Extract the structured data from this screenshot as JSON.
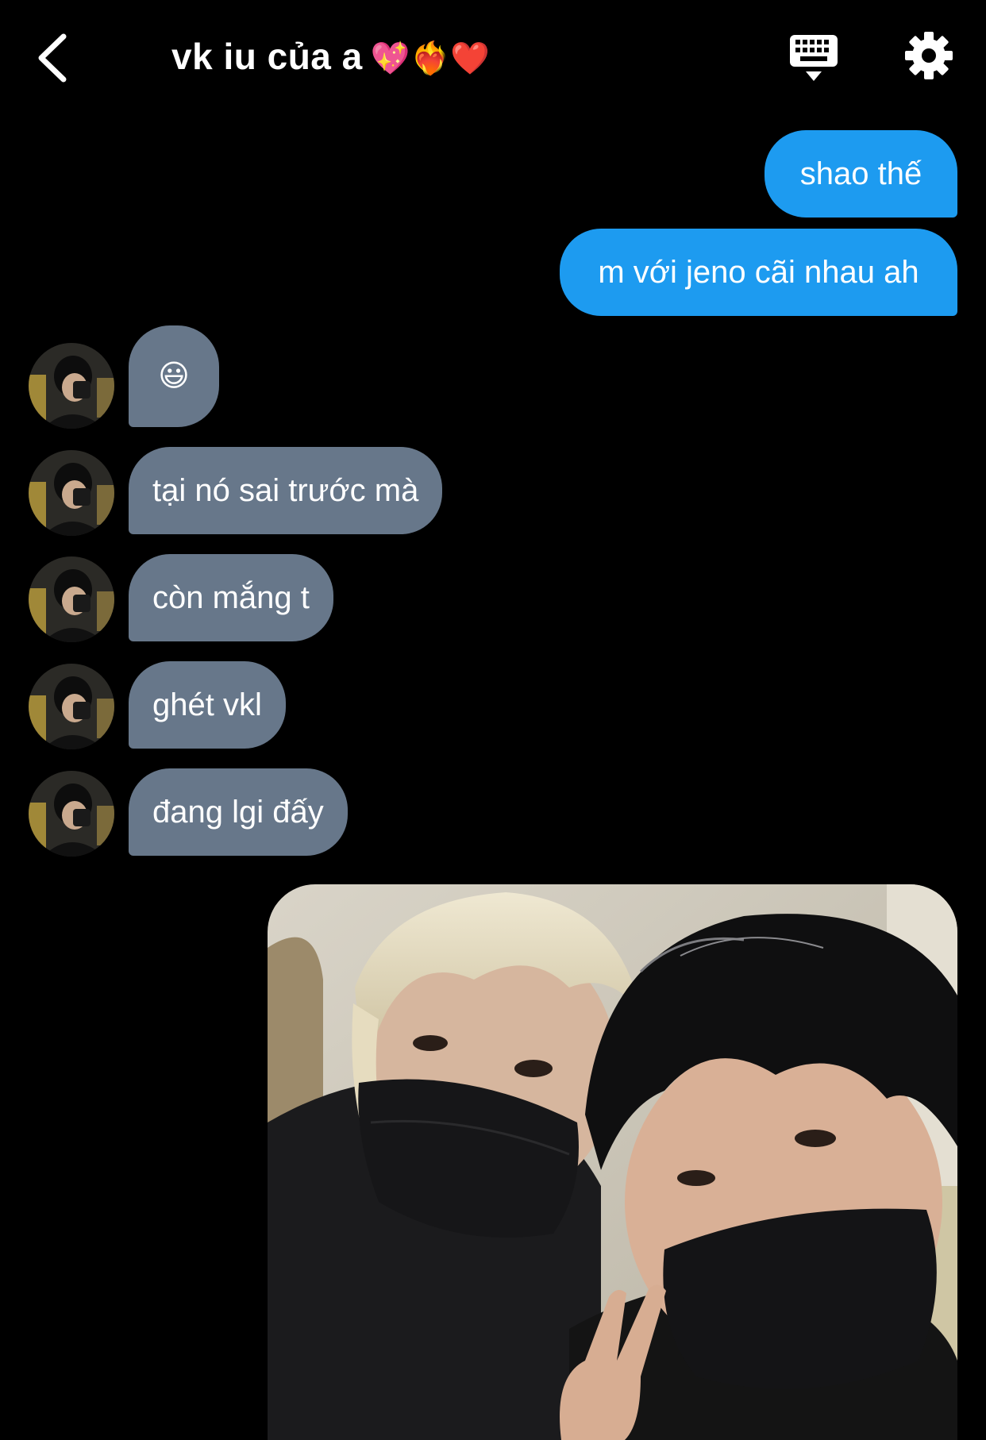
{
  "header": {
    "title": "vk iu của a",
    "title_emoji": "💖❤️‍🔥❤️",
    "back_icon": "chevron-left-icon",
    "keyboard_icon": "keyboard-icon",
    "settings_icon": "gear-icon"
  },
  "colors": {
    "background": "#000000",
    "sent_bubble": "#1d9bf0",
    "received_bubble": "#67778a"
  },
  "messages": [
    {
      "direction": "sent",
      "text": "shao thế"
    },
    {
      "direction": "sent",
      "text": "m với jeno cãi nhau ah"
    },
    {
      "direction": "received",
      "text": "😃"
    },
    {
      "direction": "received",
      "text": "tại nó sai trước mà"
    },
    {
      "direction": "received",
      "text": "còn mắng t"
    },
    {
      "direction": "received",
      "text": "ghét vkl"
    },
    {
      "direction": "received",
      "text": "đang lgi đấy"
    }
  ]
}
